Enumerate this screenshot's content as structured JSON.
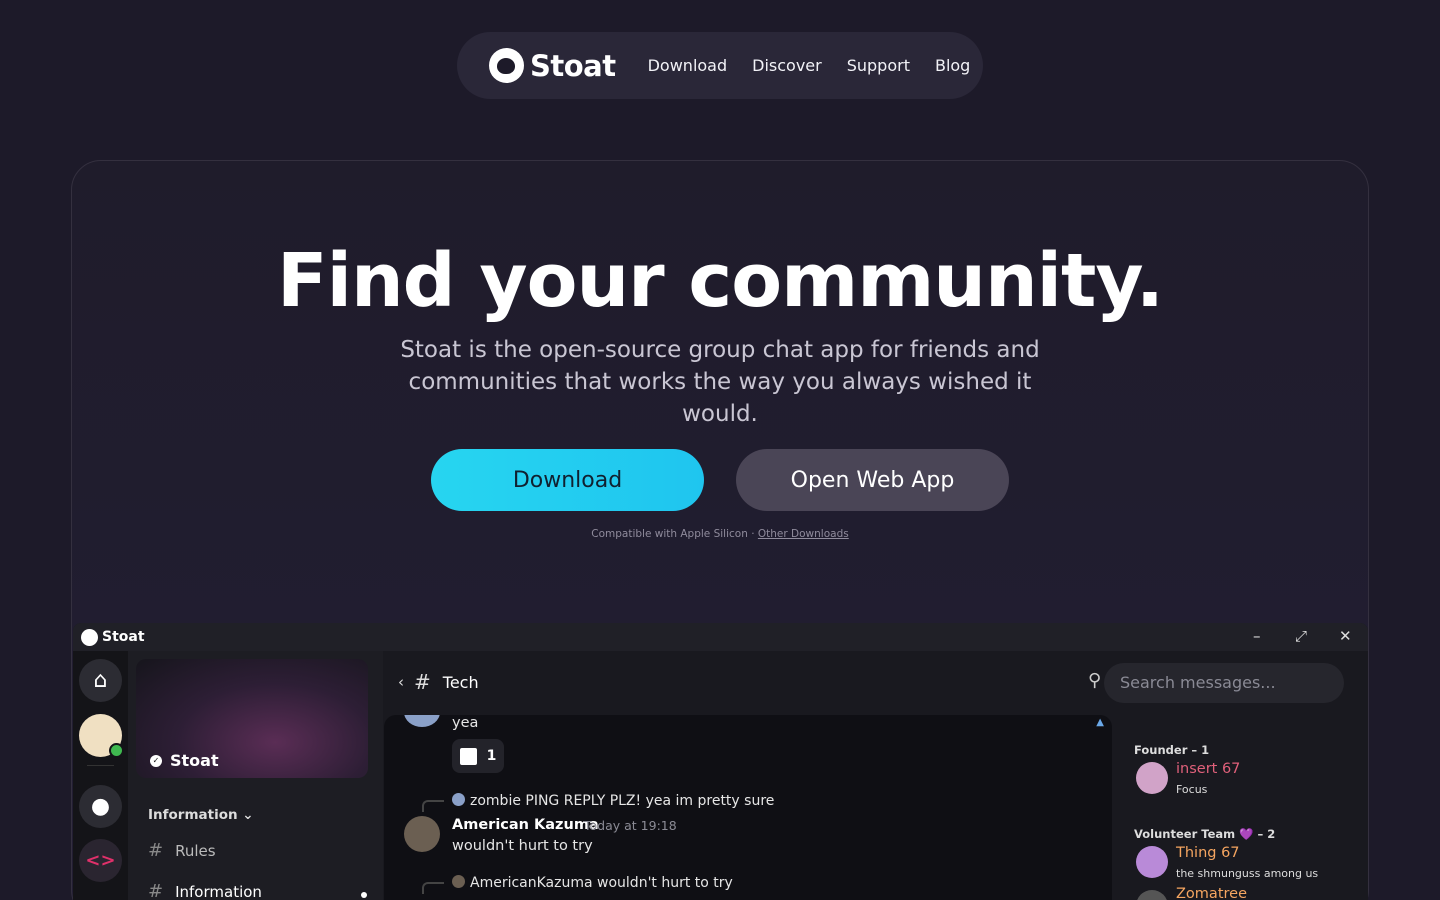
{
  "nav": {
    "brand": "Stoat",
    "links": [
      "Download",
      "Discover",
      "Support",
      "Blog"
    ]
  },
  "hero": {
    "headline": "Find your community.",
    "subhead": "Stoat is the open-source group chat app for friends and communities that works the way you always wished it would.",
    "download_label": "Download",
    "webapp_label": "Open Web App",
    "compat_text": "Compatible with Apple Silicon · ",
    "compat_link": "Other Downloads"
  },
  "colors": {
    "accent": "#27d5f0",
    "background": "#1d1a29",
    "secondary_button": "#4a4556"
  },
  "app": {
    "title": "Stoat",
    "window_controls": [
      "minimize-icon",
      "maximize-icon",
      "close-icon"
    ],
    "server_banner": "Stoat",
    "category": "Information",
    "channels": [
      "Rules",
      "Information"
    ],
    "channel_title": "Tech",
    "search_placeholder": "Search messages...",
    "messages": {
      "prev_text": "yea",
      "reaction_count": "1",
      "reply1": "zombie PING REPLY PLZ! yea im pretty sure",
      "author": "American Kazuma",
      "timestamp": "Today at 19:18",
      "body": "wouldn't hurt to try",
      "reply2": "AmericanKazuma wouldn't hurt to try"
    },
    "members": {
      "role1": "Founder – 1",
      "member1_name": "insert 67",
      "member1_status": "Focus",
      "role2": "Volunteer Team 💜 – 2",
      "member2_name": "Thing 67",
      "member2_status": "the shmunguss among us",
      "member3_name": "Zomatree"
    }
  }
}
